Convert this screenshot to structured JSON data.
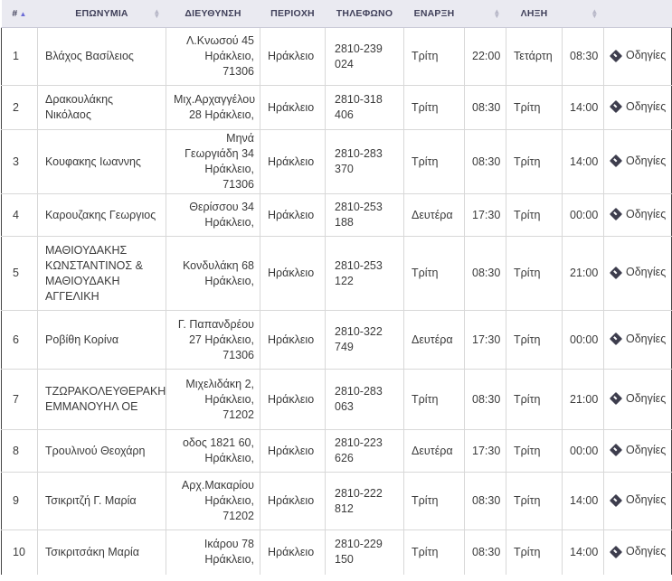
{
  "headers": {
    "num": "#",
    "name": "ΕΠΩΝΥΜΙΑ",
    "address": "ΔΙΕΥΘΥΝΣΗ",
    "area": "ΠΕΡΙΟΧΗ",
    "phone": "ΤΗΛΕΦΩΝΟ",
    "start": "ΕΝΑΡΞΗ",
    "end": "ΛΗΞΗ"
  },
  "directions_label": "Οδηγίες",
  "rows": [
    {
      "num": "1",
      "name": "Βλάχος Βασίλειος",
      "address": "Λ.Κνωσού 45 Ηράκλειο, 71306",
      "area": "Ηράκλειο",
      "phone": "2810-239 024",
      "start_day": "Τρίτη",
      "start_time": "22:00",
      "end_day": "Τετάρτη",
      "end_time": "08:30"
    },
    {
      "num": "2",
      "name": "Δρακουλάκης Νικόλαος",
      "address": "Μιχ.Αρχαγγέλου 28 Ηράκλειο,",
      "area": "Ηράκλειο",
      "phone": "2810-318 406",
      "start_day": "Τρίτη",
      "start_time": "08:30",
      "end_day": "Τρίτη",
      "end_time": "14:00"
    },
    {
      "num": "3",
      "name": "Κουφακης Ιωαννης",
      "address": "Μηνά Γεωργιάδη 34 Ηράκλειο, 71306",
      "area": "Ηράκλειο",
      "phone": "2810-283 370",
      "start_day": "Τρίτη",
      "start_time": "08:30",
      "end_day": "Τρίτη",
      "end_time": "14:00"
    },
    {
      "num": "4",
      "name": "Καρουζακης Γεωργιος",
      "address": "Θερίσσου 34 Ηράκλειο,",
      "area": "Ηράκλειο",
      "phone": "2810-253 188",
      "start_day": "Δευτέρα",
      "start_time": "17:30",
      "end_day": "Τρίτη",
      "end_time": "00:00"
    },
    {
      "num": "5",
      "name": "ΜΑΘΙΟΥΔΑΚΗΣ ΚΩΝΣΤΑΝΤΙΝΟΣ & ΜΑΘΙΟΥΔΑΚΗ ΑΓΓΕΛΙΚΗ",
      "address": "Κονδυλάκη 68 Ηράκλειο,",
      "area": "Ηράκλειο",
      "phone": "2810-253 122",
      "start_day": "Τρίτη",
      "start_time": "08:30",
      "end_day": "Τρίτη",
      "end_time": "21:00"
    },
    {
      "num": "6",
      "name": "Ροβίθη Κορίνα",
      "address": "Γ. Παπανδρέου 27 Ηράκλειο, 71306",
      "area": "Ηράκλειο",
      "phone": "2810-322 749",
      "start_day": "Δευτέρα",
      "start_time": "17:30",
      "end_day": "Τρίτη",
      "end_time": "00:00"
    },
    {
      "num": "7",
      "name": "ΤΖΩΡΑΚΟΛΕΥΘΕΡΑΚΗΣ ΕΜΜΑΝΟΥΗΛ ΟΕ",
      "address": "Μιχελιδάκη 2, Ηράκλειο, 71202",
      "area": "Ηράκλειο",
      "phone": "2810-283 063",
      "start_day": "Τρίτη",
      "start_time": "08:30",
      "end_day": "Τρίτη",
      "end_time": "21:00"
    },
    {
      "num": "8",
      "name": "Τρουλινού Θεοχάρη",
      "address": "οδος 1821 60, Ηράκλειο,",
      "area": "Ηράκλειο",
      "phone": "2810-223 626",
      "start_day": "Δευτέρα",
      "start_time": "17:30",
      "end_day": "Τρίτη",
      "end_time": "00:00"
    },
    {
      "num": "9",
      "name": "Τσικριτζή Γ. Μαρία",
      "address": "Αρχ.Μακαρίου Ηράκλειο, 71202",
      "area": "Ηράκλειο",
      "phone": "2810-222 812",
      "start_day": "Τρίτη",
      "start_time": "08:30",
      "end_day": "Τρίτη",
      "end_time": "14:00"
    },
    {
      "num": "10",
      "name": "Τσικριτσάκη Μαρία",
      "address": "Ικάρου 78 Ηράκλειο,",
      "area": "Ηράκλειο",
      "phone": "2810-229 150",
      "start_day": "Τρίτη",
      "start_time": "08:30",
      "end_day": "Τρίτη",
      "end_time": "14:00"
    }
  ]
}
